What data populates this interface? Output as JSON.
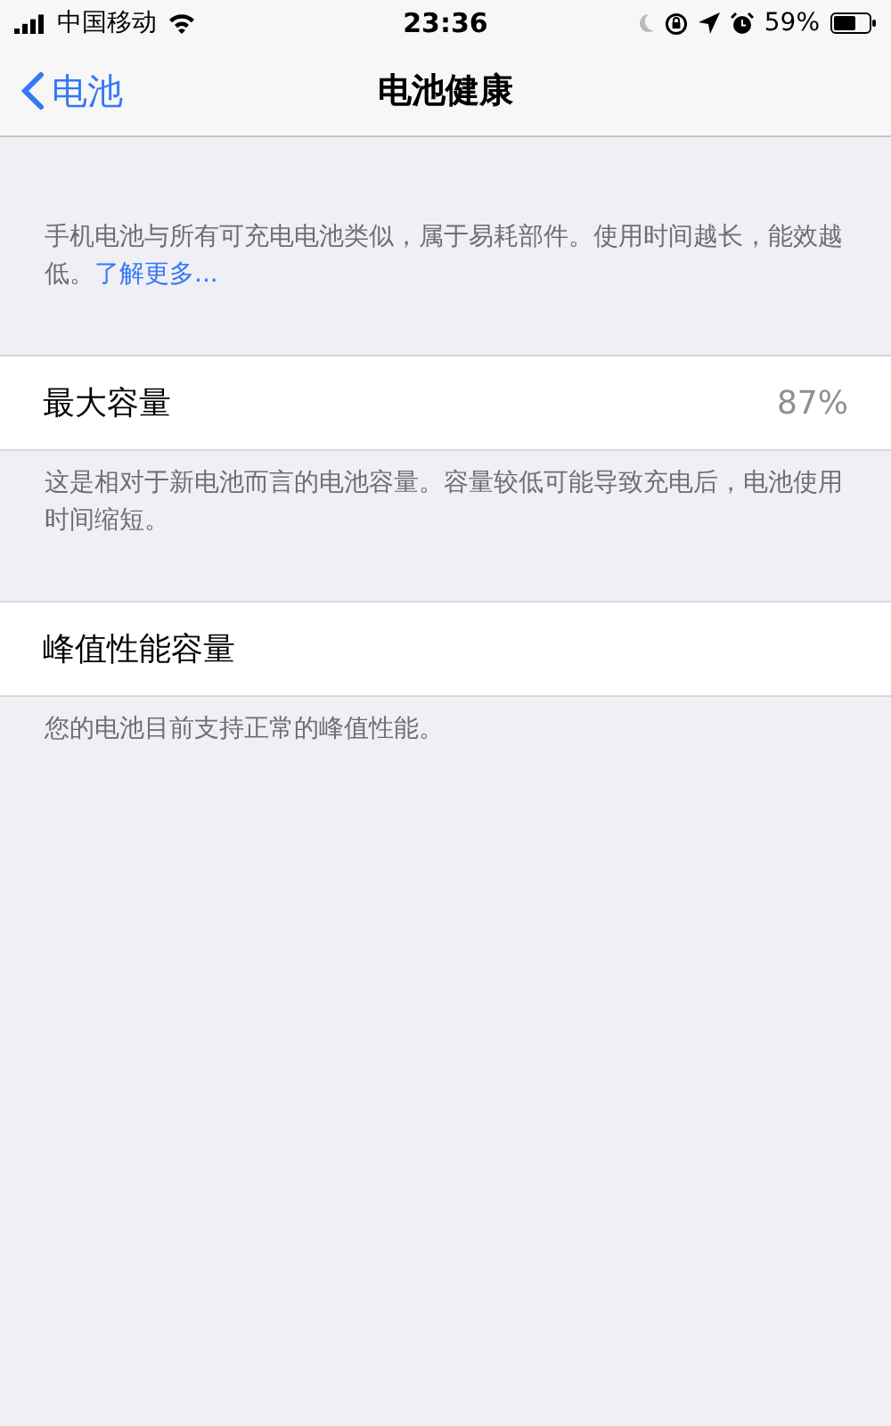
{
  "status_bar": {
    "carrier": "中国移动",
    "time": "23:36",
    "battery": "59%"
  },
  "nav": {
    "back": "电池",
    "title": "电池健康"
  },
  "intro": {
    "text": "手机电池与所有可充电电池类似，属于易耗部件。使用时间越长，能效越低。",
    "link": "了解更多..."
  },
  "sections": [
    {
      "label": "最大容量",
      "value": "87%",
      "footer": "这是相对于新电池而言的电池容量。容量较低可能导致充电后，电池使用时间缩短。"
    },
    {
      "label": "峰值性能容量",
      "footer": "您的电池目前支持正常的峰值性能。"
    }
  ]
}
